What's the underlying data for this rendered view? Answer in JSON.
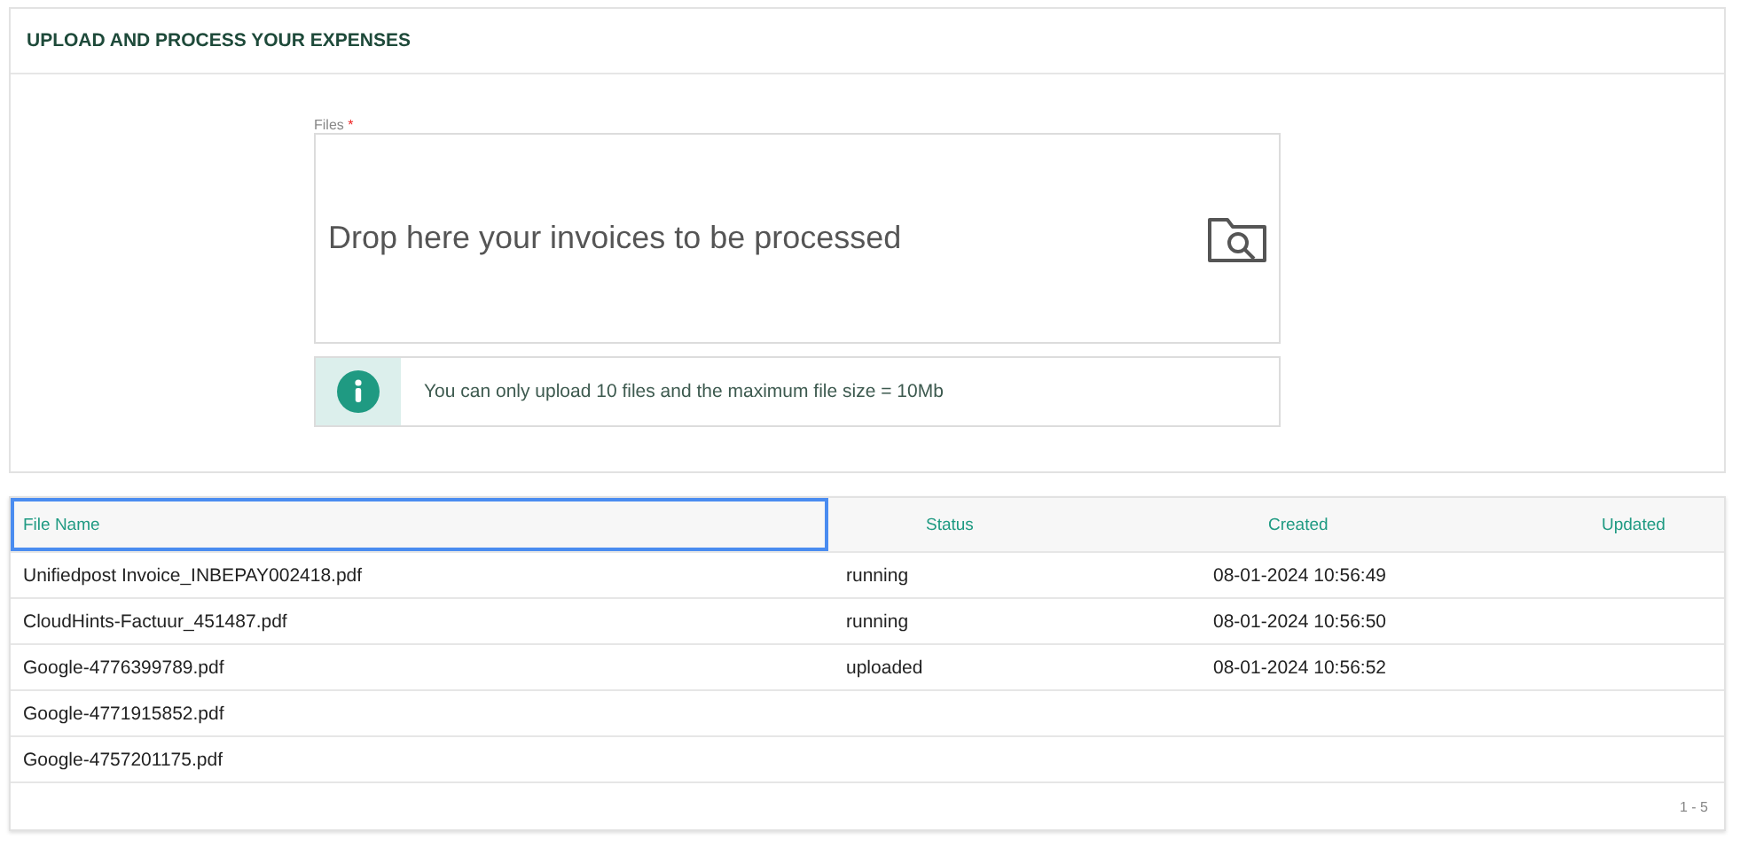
{
  "panel": {
    "title": "UPLOAD AND PROCESS YOUR EXPENSES"
  },
  "upload": {
    "label": "Files",
    "required_mark": "*",
    "dropzone_text": "Drop here your invoices to be processed",
    "info": "You can only upload 10 files and the maximum file size = 10Mb"
  },
  "table": {
    "columns": [
      {
        "label": "File Name",
        "selected": true
      },
      {
        "label": "Status",
        "selected": false
      },
      {
        "label": "Created",
        "selected": false
      },
      {
        "label": "Updated",
        "selected": false
      }
    ],
    "rows": [
      [
        "Unifiedpost Invoice_INBEPAY002418.pdf",
        "running",
        "08-01-2024 10:56:49",
        ""
      ],
      [
        "CloudHints-Factuur_451487.pdf",
        "running",
        "08-01-2024 10:56:50",
        ""
      ],
      [
        "Google-4776399789.pdf",
        "uploaded",
        "08-01-2024 10:56:52",
        ""
      ],
      [
        "Google-4771915852.pdf",
        "",
        "",
        ""
      ],
      [
        "Google-4757201175.pdf",
        "",
        "",
        ""
      ]
    ],
    "pagination": "1 - 5"
  }
}
